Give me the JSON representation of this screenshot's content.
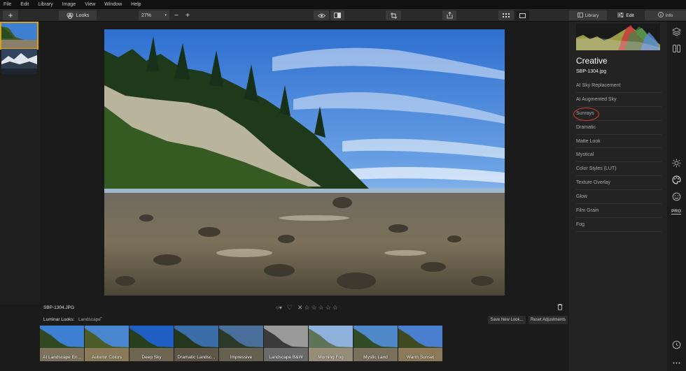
{
  "menu": [
    "File",
    "Edit",
    "Library",
    "Image",
    "View",
    "Window",
    "Help"
  ],
  "toolbar": {
    "add_label": "+",
    "looks_label": "Looks",
    "zoom_value": "27%",
    "zoom_out": "−",
    "zoom_in": "+"
  },
  "tabs": [
    {
      "label": "Library",
      "icon": "library-icon"
    },
    {
      "label": "Edit",
      "icon": "sliders-icon"
    },
    {
      "label": "Info",
      "icon": "info-icon"
    }
  ],
  "panel": {
    "title": "Creative",
    "filename": "SBP-1304.jpg",
    "items": [
      "AI Sky Replacement",
      "AI Augmented Sky",
      "Sunrays",
      "Dramatic",
      "Matte Look",
      "Mystical",
      "Color Styles (LUT)",
      "Texture Overlay",
      "Glow",
      "Film Grain",
      "Fog"
    ],
    "highlighted_item": "Sunrays",
    "highlight_color": "#d9412b"
  },
  "info": {
    "filename": "SBP-1304.JPG",
    "rating_stars": 5,
    "rating_value": 0
  },
  "looks": {
    "title": "Luminar Looks:",
    "category": "Landscape",
    "save_label": "Save New Look...",
    "reset_label": "Reset Adjustments",
    "presets": [
      "AI Landscape En...",
      "Autumn Colors",
      "Deep Sky",
      "Dramatic Landsc...",
      "Impressive",
      "Landscape B&W",
      "Morning Fog",
      "Mystic Land",
      "Warm Sunset"
    ]
  },
  "right_icons": [
    "layers-icon",
    "compare-icon",
    "sun-icon",
    "palette-icon",
    "face-icon",
    "pro-icon",
    "history-icon",
    "more-icon"
  ],
  "pro_label": "PRO",
  "accent_selected": "#d9a019"
}
